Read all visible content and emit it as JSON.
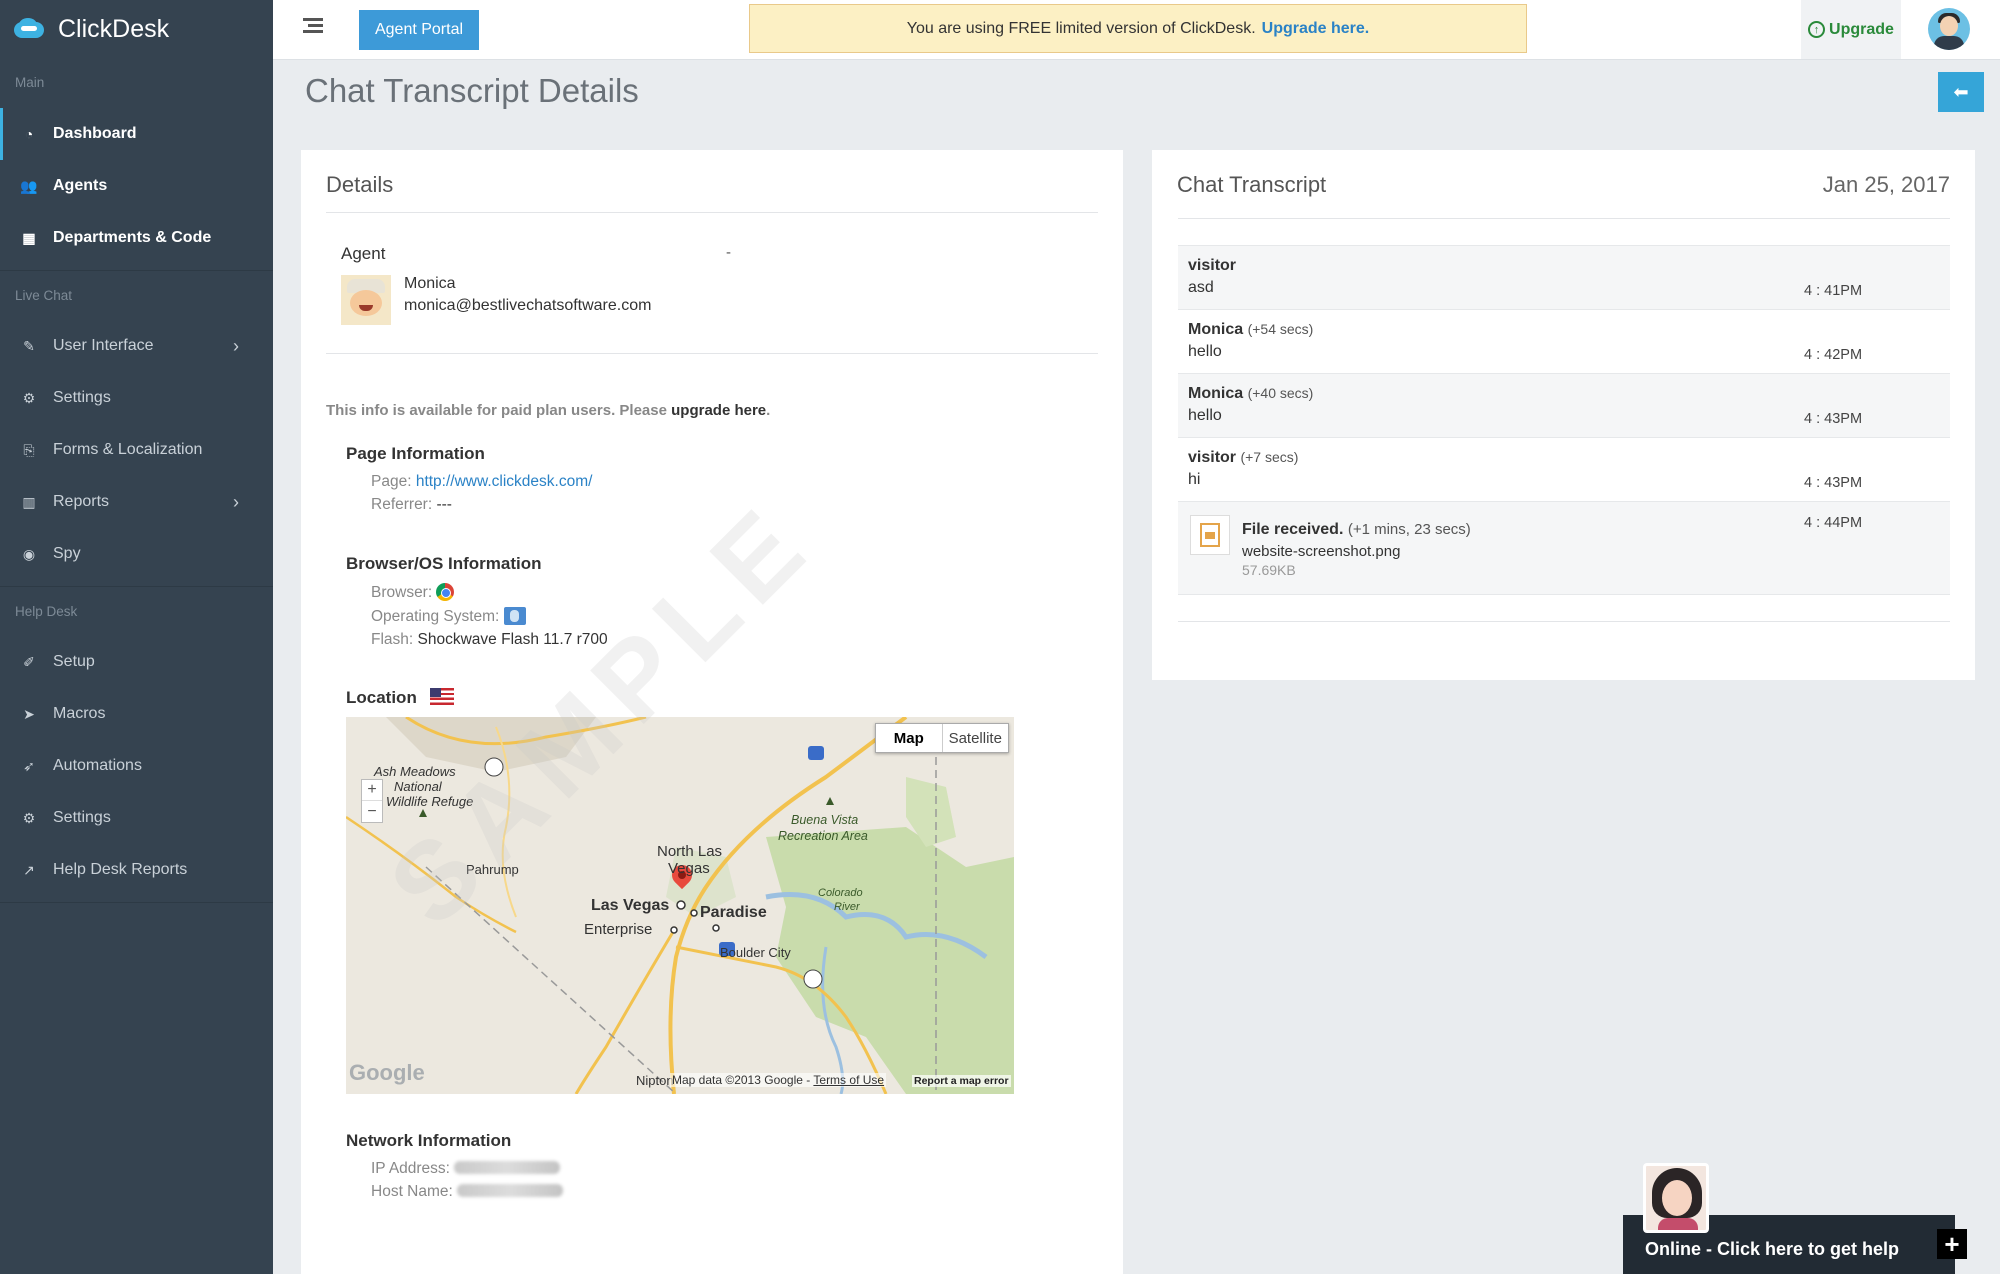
{
  "brand": {
    "name": "ClickDesk"
  },
  "sidebar": {
    "sections": [
      {
        "label": "Main"
      },
      {
        "label": "Live Chat"
      },
      {
        "label": "Help Desk"
      }
    ],
    "items": [
      {
        "label": "Dashboard",
        "icon": "dashboard-icon"
      },
      {
        "label": "Agents",
        "icon": "users-icon"
      },
      {
        "label": "Departments & Code",
        "icon": "grid-icon"
      },
      {
        "label": "User Interface",
        "icon": "brush-icon"
      },
      {
        "label": "Settings",
        "icon": "gear-icon"
      },
      {
        "label": "Forms & Localization",
        "icon": "translate-icon"
      },
      {
        "label": "Reports",
        "icon": "bar-chart-icon"
      },
      {
        "label": "Spy",
        "icon": "eye-icon"
      },
      {
        "label": "Setup",
        "icon": "wrench-icon"
      },
      {
        "label": "Macros",
        "icon": "paper-plane-icon"
      },
      {
        "label": "Automations",
        "icon": "rocket-icon"
      },
      {
        "label": "Settings",
        "icon": "gear-icon"
      },
      {
        "label": "Help Desk Reports",
        "icon": "line-chart-icon"
      }
    ]
  },
  "topbar": {
    "agent_portal": "Agent Portal",
    "banner_text": "You are using FREE limited version of ClickDesk.",
    "banner_link": "Upgrade here.",
    "upgrade": "Upgrade"
  },
  "page": {
    "title": "Chat Transcript Details"
  },
  "details": {
    "title": "Details",
    "agent_label": "Agent",
    "agent_dash": "-",
    "agent_name": "Monica",
    "agent_email": "monica@bestlivechatsoftware.com",
    "paid_note": "This info is available for paid plan users. Please",
    "paid_link": "upgrade here",
    "paid_end": ".",
    "page_info": {
      "heading": "Page Information",
      "page_label": "Page:",
      "page_url": "http://www.clickdesk.com/",
      "referrer_label": "Referrer:",
      "referrer_value": "---"
    },
    "browser_info": {
      "heading": "Browser/OS Information",
      "browser_label": "Browser:",
      "os_label": "Operating System:",
      "flash_label": "Flash:",
      "flash_value": "Shockwave Flash 11.7 r700"
    },
    "location": {
      "heading": "Location",
      "map_button": "Map",
      "satellite_button": "Satellite",
      "labels": {
        "ash_meadows": "Ash Meadows",
        "national": "National",
        "wildlife": "Wildlife Refuge",
        "pahrump": "Pahrump",
        "north_las": "North Las",
        "vegas": "Vegas",
        "las_vegas": "Las Vegas",
        "paradise": "Paradise",
        "enterprise": "Enterprise",
        "buena_vista": "Buena Vista",
        "recreation": "Recreation Area",
        "colorado": "Colorado",
        "river": "River",
        "boulder_city": "Boulder City",
        "nipton": "Nipton"
      },
      "attribution": "Map data ©2013 Google",
      "terms": "Terms of Use",
      "report": "Report a map error",
      "google": "Google",
      "watermark": "SAMPLE"
    },
    "network_info": {
      "heading": "Network Information",
      "ip_label": "IP Address:",
      "host_label": "Host Name:"
    }
  },
  "transcript": {
    "title": "Chat Transcript",
    "date": "Jan 25, 2017",
    "messages": [
      {
        "sender": "visitor",
        "delta": "",
        "text": "asd",
        "time": "4 : 41PM"
      },
      {
        "sender": "Monica",
        "delta": "(+54 secs)",
        "text": "hello",
        "time": "4 : 42PM"
      },
      {
        "sender": "Monica",
        "delta": "(+40 secs)",
        "text": "hello",
        "time": "4 : 43PM"
      },
      {
        "sender": "visitor",
        "delta": "(+7 secs)",
        "text": "hi",
        "time": "4 : 43PM"
      }
    ],
    "file": {
      "label": "File received.",
      "delta": "(+1 mins, 23 secs)",
      "name": "website-screenshot.png",
      "size": "57.69KB",
      "time": "4 : 44PM"
    }
  },
  "chat_widget": {
    "label": "Online - Click here to get help",
    "plus": "+"
  }
}
